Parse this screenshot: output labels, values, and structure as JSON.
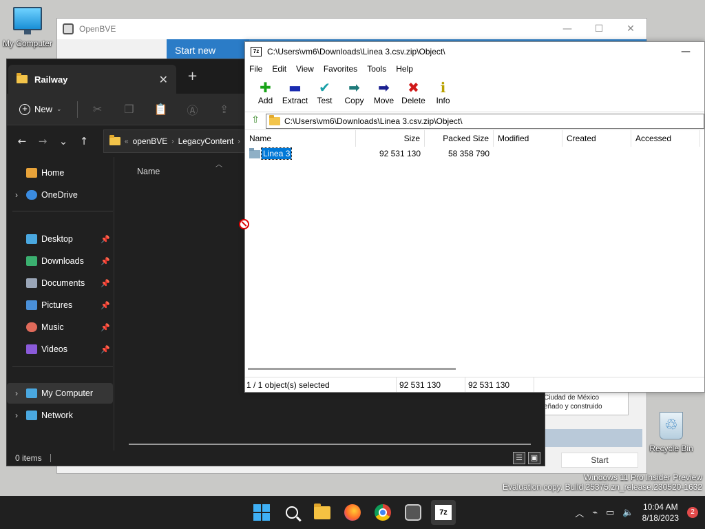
{
  "desktop": {
    "my_computer_label": "My Computer",
    "recycle_bin_label": "Recycle Bin",
    "watermark_line1": "Windows 11 Pro Insider Preview",
    "watermark_line2": "Evaluation copy. Build 25375.zn_release.230520-1632"
  },
  "openbve": {
    "title": "OpenBVE",
    "controls": {
      "minimize": "—",
      "maximize": "☐",
      "close": "✕"
    },
    "tab_label": "Start new game",
    "panel_line1": "Ciudad de México",
    "panel_line2": "eñado y construido",
    "start_label": "Start"
  },
  "explorer": {
    "tab_title": "Railway",
    "tab_close": "✕",
    "new_tab": "+",
    "new_label": "New",
    "breadcrumb": [
      "openBVE",
      "LegacyContent"
    ],
    "nav": {
      "back": "←",
      "forward": "→",
      "recent": "⌄",
      "up": "↑"
    },
    "sidebar": [
      {
        "label": "Home",
        "color": "#e8a33a",
        "caret": ""
      },
      {
        "label": "OneDrive",
        "color": "#3a8be0",
        "caret": "›"
      },
      {
        "label": "Desktop",
        "color": "#4aa8e0",
        "caret": ""
      },
      {
        "label": "Downloads",
        "color": "#3bb070",
        "caret": ""
      },
      {
        "label": "Documents",
        "color": "#9aa6b8",
        "caret": ""
      },
      {
        "label": "Pictures",
        "color": "#4a90d9",
        "caret": ""
      },
      {
        "label": "Music",
        "color": "#e06a5a",
        "caret": ""
      },
      {
        "label": "Videos",
        "color": "#8a5ad9",
        "caret": ""
      },
      {
        "label": "My Computer",
        "color": "#4aa8e0",
        "caret": "›"
      },
      {
        "label": "Network",
        "color": "#4aa8e0",
        "caret": "›"
      }
    ],
    "column_name": "Name",
    "status": "0 items"
  },
  "zip": {
    "title": "C:\\Users\\vm6\\Downloads\\Linea 3.csv.zip\\Object\\",
    "minimize": "—",
    "menu": [
      "File",
      "Edit",
      "View",
      "Favorites",
      "Tools",
      "Help"
    ],
    "tools": [
      {
        "label": "Add",
        "glyph": "✚",
        "color": "#19a319"
      },
      {
        "label": "Extract",
        "glyph": "▬",
        "color": "#1a2bb0"
      },
      {
        "label": "Test",
        "glyph": "✔",
        "color": "#1aa0a8"
      },
      {
        "label": "Copy",
        "glyph": "➡",
        "color": "#1e7a7a"
      },
      {
        "label": "Move",
        "glyph": "➡",
        "color": "#1a2090"
      },
      {
        "label": "Delete",
        "glyph": "✖",
        "color": "#d01818"
      },
      {
        "label": "Info",
        "glyph": "ℹ",
        "color": "#b8a000"
      }
    ],
    "path": "C:\\Users\\vm6\\Downloads\\Linea 3.csv.zip\\Object\\",
    "columns": [
      "Name",
      "Size",
      "Packed Size",
      "Modified",
      "Created",
      "Accessed"
    ],
    "rows": [
      {
        "name": "Linea 3",
        "size": "92 531 130",
        "packed": "58 358 790",
        "modified": "",
        "created": "",
        "accessed": ""
      }
    ],
    "status": {
      "selected": "1 / 1 object(s) selected",
      "size": "92 531 130",
      "total": "92 531 130"
    }
  },
  "taskbar": {
    "time": "10:04 AM",
    "date": "8/18/2023",
    "notifications": "2",
    "tray": {
      "chevron": "︿",
      "network": "⌁",
      "display": "▭",
      "volume": "🔈"
    }
  }
}
